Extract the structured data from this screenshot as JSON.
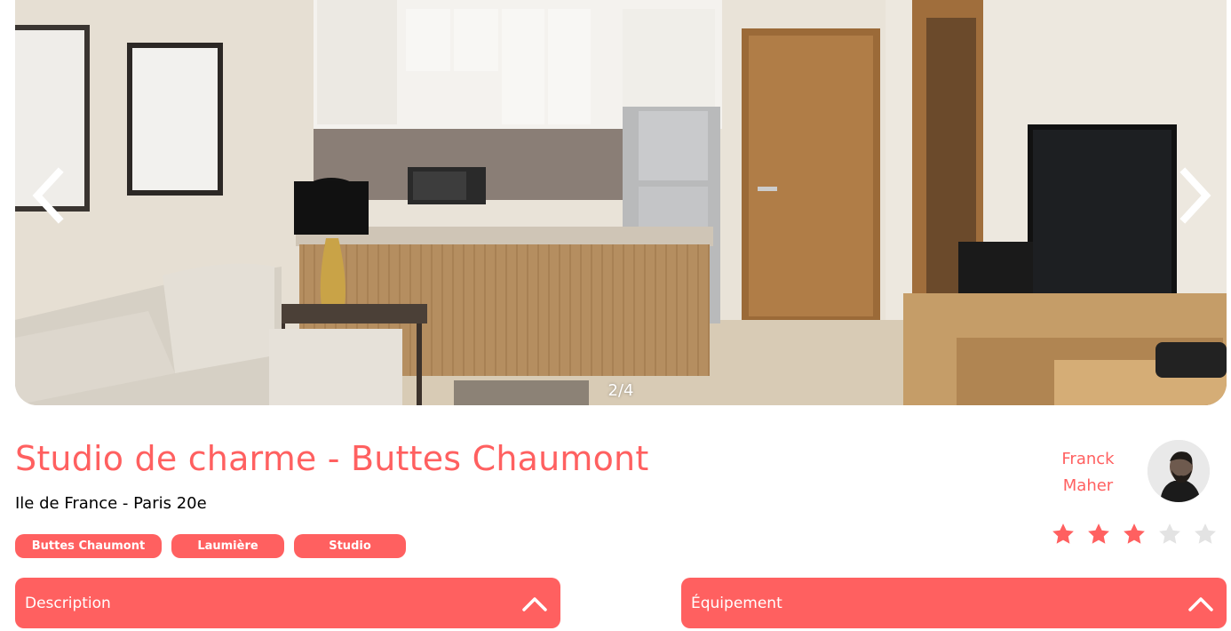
{
  "gallery": {
    "counter": "2/4",
    "prev_icon": "chevron-left-icon",
    "next_icon": "chevron-right-icon"
  },
  "listing": {
    "title": "Studio de charme - Buttes Chaumont",
    "location": "Ile de France - Paris 20e",
    "tags": [
      "Buttes Chaumont",
      "Laumière",
      "Studio"
    ]
  },
  "host": {
    "first_name": "Franck",
    "last_name": "Maher"
  },
  "rating": {
    "value": 3,
    "max": 5
  },
  "collapses": {
    "description": "Description",
    "equipment": "Équipement",
    "toggle_icon": "chevron-up-icon"
  },
  "colors": {
    "accent": "#ff6060",
    "star_empty": "#e3e3e3",
    "text": "#000000"
  }
}
